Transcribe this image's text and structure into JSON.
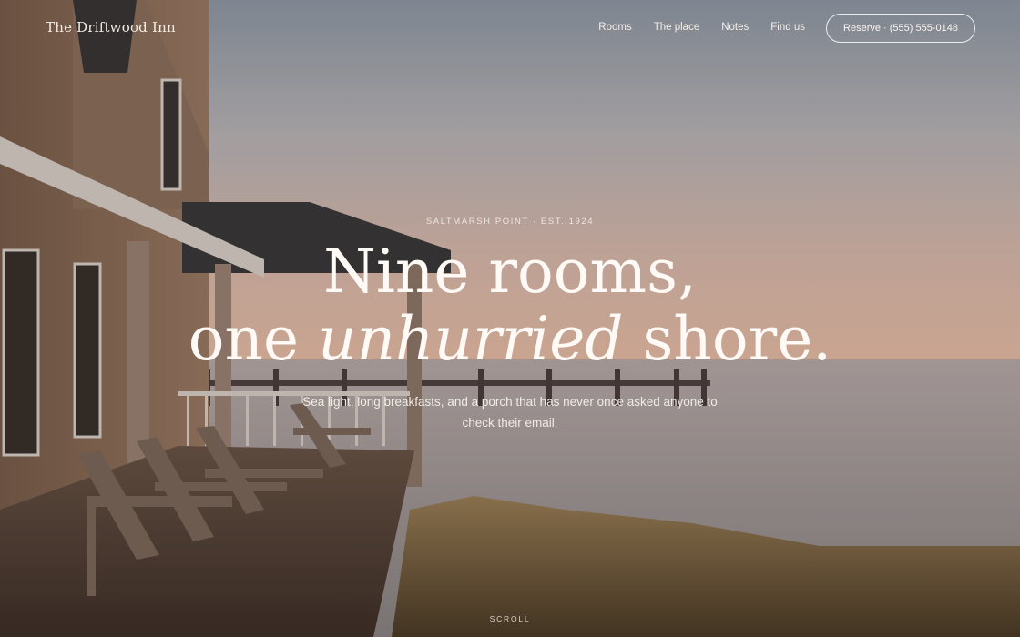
{
  "nav": {
    "brand": "The Driftwood Inn",
    "links": [
      "Rooms",
      "The place",
      "Notes",
      "Find us"
    ],
    "reserve": "Reserve · (555) 555-0148"
  },
  "hero": {
    "eyebrow": "SALTMARSH POINT · EST. 1924",
    "headline_line1": "Nine rooms,",
    "headline_line2_start": "one ",
    "headline_line2_em": "unhurried",
    "headline_line2_end": " shore.",
    "subtitle": "Sea light, long breakfasts, and a porch that has never once asked anyone to check their email.",
    "scroll": "SCROLL"
  },
  "colors": {
    "sky_top": "#9aa3ad",
    "sky_glow": "#e2b8a2",
    "water": "#a39897",
    "shingle": "#8a6c58",
    "trim": "#d8cfc6"
  }
}
